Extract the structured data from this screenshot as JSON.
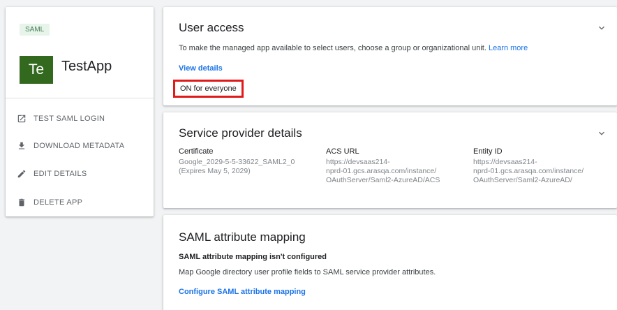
{
  "app_card": {
    "badge": "SAML",
    "avatar_initials": "Te",
    "app_name": "TestApp",
    "actions": [
      {
        "label": "TEST SAML LOGIN",
        "icon": "open-in-new-icon"
      },
      {
        "label": "DOWNLOAD METADATA",
        "icon": "download-icon"
      },
      {
        "label": "EDIT DETAILS",
        "icon": "pencil-icon"
      },
      {
        "label": "DELETE APP",
        "icon": "trash-icon"
      }
    ]
  },
  "user_access": {
    "title": "User access",
    "description": "To make the managed app available to select users, choose a group or organizational unit.",
    "learn_more": "Learn more",
    "view_details": "View details",
    "status": "ON for everyone"
  },
  "sp_details": {
    "title": "Service provider details",
    "certificate_label": "Certificate",
    "certificate_value": "Google_2029-5-5-33622_SAML2_0",
    "certificate_expiry": "(Expires May 5, 2029)",
    "acs_label": "ACS URL",
    "acs_lines": [
      "https://devsaas214-",
      "nprd-01.gcs.arasqa.com/instance/",
      "OAuthServer/Saml2-AzureAD/ACS"
    ],
    "entity_label": "Entity ID",
    "entity_lines": [
      "https://devsaas214-",
      "nprd-01.gcs.arasqa.com/instance/",
      "OAuthServer/Saml2-AzureAD/"
    ]
  },
  "saml_mapping": {
    "title": "SAML attribute mapping",
    "status": "SAML attribute mapping isn't configured",
    "description": "Map Google directory user profile fields to SAML service provider attributes.",
    "configure_link": "Configure SAML attribute mapping"
  },
  "colors": {
    "accent": "#1a73e8",
    "avatar_bg": "#33691e",
    "highlight_border": "#e01a1a"
  }
}
